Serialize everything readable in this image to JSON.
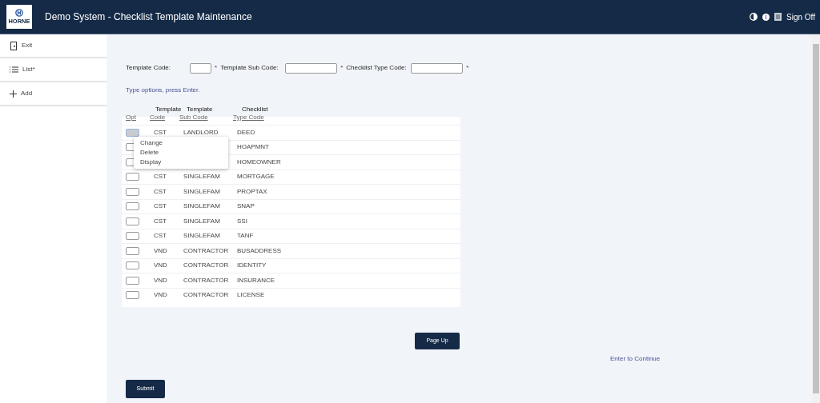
{
  "header": {
    "logo_text": "HORNE",
    "title": "Demo System - Checklist Template Maintenance",
    "sign_off": "Sign Off"
  },
  "sidebar": {
    "items": [
      {
        "kind": "exit",
        "label": "Exit"
      },
      {
        "kind": "list",
        "label": "List*"
      },
      {
        "kind": "add",
        "label": "Add"
      }
    ]
  },
  "filters": [
    {
      "label": "Template Code:",
      "required": "*"
    },
    {
      "label": "Template Sub Code:",
      "required": "*"
    },
    {
      "label": "Checklist Type Code:",
      "required": "*"
    }
  ],
  "instructions": "Type options, press Enter.",
  "table": {
    "columns": [
      {
        "label": "Opt"
      },
      {
        "top": "Template",
        "label": "Code"
      },
      {
        "top": "Template",
        "label": "Sub Code"
      },
      {
        "top": "Checklist",
        "label": "Type Code"
      }
    ],
    "rows": [
      {
        "focused": true,
        "code": "CST",
        "sub_code": "LANDLORD",
        "type_code": "DEED"
      },
      {
        "focused": false,
        "type_code": "HOAPMNT"
      },
      {
        "focused": false,
        "type_code": "HOMEOWNER"
      },
      {
        "focused": false,
        "code": "CST",
        "sub_code": "SINGLEFAM",
        "type_code": "MORTGAGE"
      },
      {
        "focused": false,
        "code": "CST",
        "sub_code": "SINGLEFAM",
        "type_code": "PROPTAX"
      },
      {
        "focused": false,
        "code": "CST",
        "sub_code": "SINGLEFAM",
        "type_code": "SNAP"
      },
      {
        "focused": false,
        "code": "CST",
        "sub_code": "SINGLEFAM",
        "type_code": "SSI"
      },
      {
        "focused": false,
        "code": "CST",
        "sub_code": "SINGLEFAM",
        "type_code": "TANF"
      },
      {
        "focused": false,
        "code": "VND",
        "sub_code": "CONTRACTOR",
        "type_code": "BUSADDRESS"
      },
      {
        "focused": false,
        "code": "VND",
        "sub_code": "CONTRACTOR",
        "type_code": "IDENTITY"
      },
      {
        "focused": false,
        "code": "VND",
        "sub_code": "CONTRACTOR",
        "type_code": "INSURANCE"
      },
      {
        "focused": false,
        "code": "VND",
        "sub_code": "CONTRACTOR",
        "type_code": "LICENSE"
      }
    ]
  },
  "option_menu": [
    "Change",
    "Delete",
    "Display"
  ],
  "page_up": "Page Up",
  "enter_hint": "Enter to Continue",
  "submit": "Submit"
}
